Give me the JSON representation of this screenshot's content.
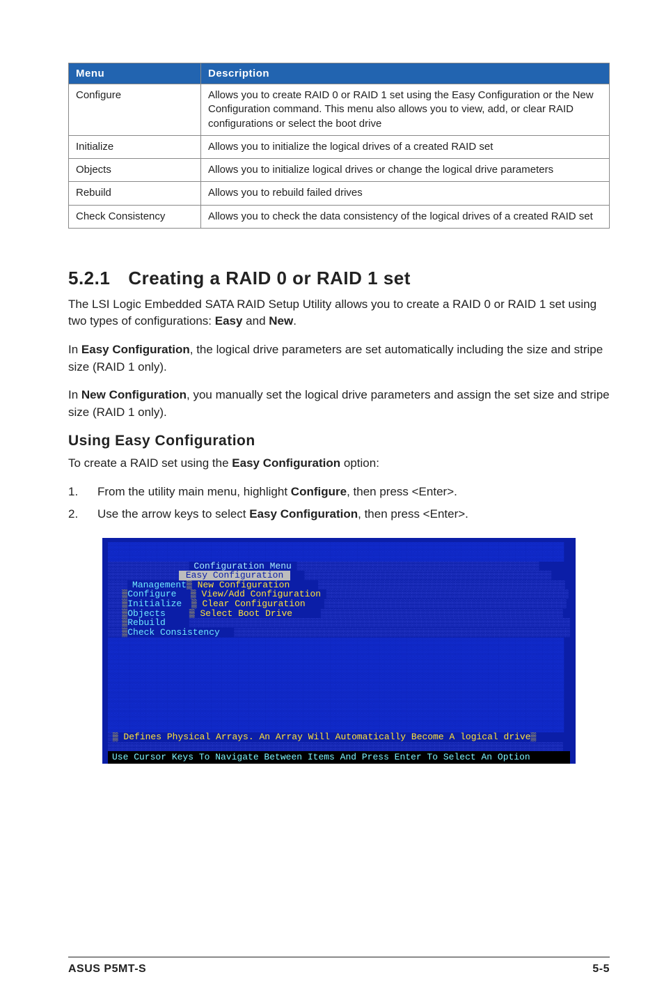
{
  "table": {
    "headers": {
      "menu": "Menu",
      "desc": "Description"
    },
    "rows": [
      {
        "menu": "Configure",
        "desc": "Allows you to create RAID 0 or RAID 1 set using the Easy Configuration or the New Configuration command. This menu also allows you to view, add, or clear RAID configurations or select the boot drive"
      },
      {
        "menu": "Initialize",
        "desc": "Allows you to initialize the logical drives of a created RAID set"
      },
      {
        "menu": "Objects",
        "desc": "Allows you to initialize logical drives or change the logical drive parameters"
      },
      {
        "menu": "Rebuild",
        "desc": "Allows you to rebuild failed drives"
      },
      {
        "menu": "Check Consistency",
        "desc": "Allows you to check the data consistency of the logical drives of a created RAID set"
      }
    ]
  },
  "section": {
    "num": "5.2.1",
    "title": "Creating a RAID 0 or RAID 1 set",
    "p1a": "The LSI Logic Embedded SATA RAID Setup Utility allows you to create a RAID 0 or RAID 1 set using two types of configurations: ",
    "p1b": " and ",
    "easy": "Easy",
    "new": "New",
    "period": ".",
    "p2a": "In ",
    "easycfg": "Easy Configuration",
    "p2b": ", the logical drive parameters are set automatically including the size and stripe size (RAID 1 only).",
    "p3a": "In ",
    "newcfg": "New Configuration",
    "p3b": ", you manually set the logical drive parameters and assign the set size and stripe size (RAID 1 only)."
  },
  "using": {
    "heading": "Using Easy Configuration",
    "intro_a": "To create a RAID set using the ",
    "intro_b": "Easy Configuration",
    "intro_c": " option:",
    "step1a": "From the utility main menu, highlight ",
    "step1b": "Configure",
    "step1c": ", then press <Enter>.",
    "step2a": "Use the arrow keys to select ",
    "step2b": "Easy Configuration",
    "step2c": ", then press <Enter>."
  },
  "shot": {
    "cfg_menu": " Configuration Menu ",
    "easy_cfg": " Easy Configuration ",
    "mgmt": " Management",
    "new_cfg": " New Configuration",
    "configure_lbl": "Configure",
    "view_add": " View/Add Configuration ",
    "initialize_lbl": "Initialize",
    "clear_cfg": " Clear Configuration",
    "objects_lbl": "Objects",
    "sel_boot": " Select Boot Drive",
    "rebuild_lbl": "Rebuild",
    "check_lbl": "Check Consistency",
    "hint1a": " Defines Physical Arrays. An Array Will Automatically Become A logical drive",
    "hint2": "Use Cursor Keys To Navigate Between Items And Press Enter To Select An Option"
  },
  "footer": {
    "left": "ASUS P5MT-S",
    "right": "5-5"
  }
}
